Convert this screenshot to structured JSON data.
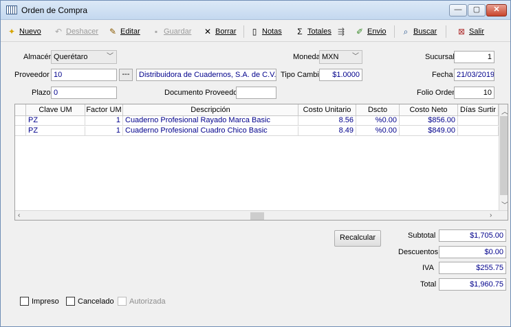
{
  "window": {
    "title": "Orden de Compra",
    "minimize": "—",
    "maximize": "▢",
    "close": "✕"
  },
  "toolbar": {
    "nuevo": "Nuevo",
    "deshacer": "Deshacer",
    "editar": "Editar",
    "guardar": "Guardar",
    "borrar": "Borrar",
    "notas": "Notas",
    "totales": "Totales",
    "envio": "Envio",
    "buscar": "Buscar",
    "salir": "Salir"
  },
  "form": {
    "almacen_label": "Almacén",
    "almacen_value": "Querétaro",
    "moneda_label": "Moneda",
    "moneda_value": "MXN",
    "sucursal_label": "Sucursal",
    "sucursal_value": "1",
    "proveedor_label": "Proveedor",
    "proveedor_code": "10",
    "proveedor_lookup": "---",
    "proveedor_name": "Distribuidora de Cuadernos, S.A. de C.V.",
    "tipo_cambio_label": "Tipo Cambio",
    "tipo_cambio_value": "$1.0000",
    "fecha_label": "Fecha",
    "fecha_value": "21/03/2019",
    "plazo_label": "Plazo",
    "plazo_value": "0",
    "documento_label": "Documento Proveedor",
    "documento_value": "",
    "folio_label": "Folio Orden",
    "folio_value": "10"
  },
  "grid": {
    "columns": [
      "Clave UM",
      "Factor UM",
      "Descripción",
      "Costo Unitario",
      "Dscto",
      "Costo Neto",
      "Días Surtir"
    ],
    "rows": [
      {
        "clave": "PZ",
        "factor": "1",
        "descripcion": "Cuaderno Profesional Rayado Marca Basic",
        "costo": "8.56",
        "dscto": "%0.00",
        "neto": "$856.00",
        "dias": ""
      },
      {
        "clave": "PZ",
        "factor": "1",
        "descripcion": "Cuaderno Profesional Cuadro Chico Basic",
        "costo": "8.49",
        "dscto": "%0.00",
        "neto": "$849.00",
        "dias": ""
      }
    ]
  },
  "totals": {
    "recalcular": "Recalcular",
    "subtotal_label": "Subtotal",
    "subtotal_value": "$1,705.00",
    "descuentos_label": "Descuentos",
    "descuentos_value": "$0.00",
    "iva_label": "IVA",
    "iva_value": "$255.75",
    "total_label": "Total",
    "total_value": "$1,960.75"
  },
  "checks": {
    "impreso": "Impreso",
    "cancelado": "Cancelado",
    "autorizada": "Autorizada"
  },
  "colors": {
    "link_text": "#00008b",
    "title_bar": "#c4d8ef",
    "close_button": "#c8452d"
  }
}
